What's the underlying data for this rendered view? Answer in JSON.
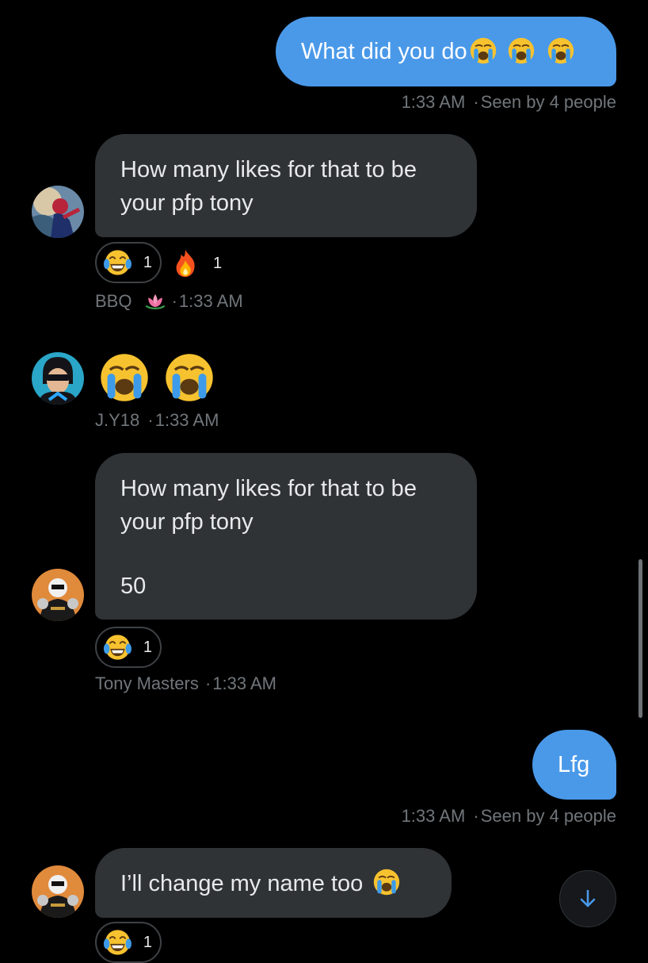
{
  "messages": [
    {
      "id": "m1",
      "text": "What did you do",
      "emoji_count": 3,
      "time": "1:33 AM",
      "status": "Seen by 4 people"
    },
    {
      "id": "m2",
      "text": "How many likes for that to be your pfp tony",
      "reactions": [
        {
          "icon": "tears-of-joy-emoji",
          "count": "1"
        },
        {
          "icon": "fire-emoji",
          "count": "1"
        }
      ],
      "sender": "BBQ",
      "time": "1:33 AM"
    },
    {
      "id": "m3",
      "emoji_count": 2,
      "sender": "J.Y18",
      "time": "1:33 AM"
    },
    {
      "id": "m4",
      "text_line1": "How many likes for that to be",
      "text_line2": "your pfp tony",
      "text_line3": "50",
      "reactions": [
        {
          "icon": "tears-of-joy-emoji",
          "count": "1"
        }
      ],
      "sender": "Tony Masters",
      "time": "1:33 AM"
    },
    {
      "id": "m5",
      "text": "Lfg",
      "time": "1:33 AM",
      "status": "Seen by 4 people"
    },
    {
      "id": "m6",
      "text": "I’ll change my name too",
      "reactions": [
        {
          "icon": "tears-of-joy-emoji",
          "count": "1"
        }
      ]
    }
  ],
  "separator": "·",
  "colors": {
    "outgoing_bubble": "#4a99e9",
    "incoming_bubble": "#2f3336",
    "meta_text": "#71767b",
    "background": "#000000"
  },
  "icons": {
    "scroll_down": "arrow-down-icon"
  }
}
